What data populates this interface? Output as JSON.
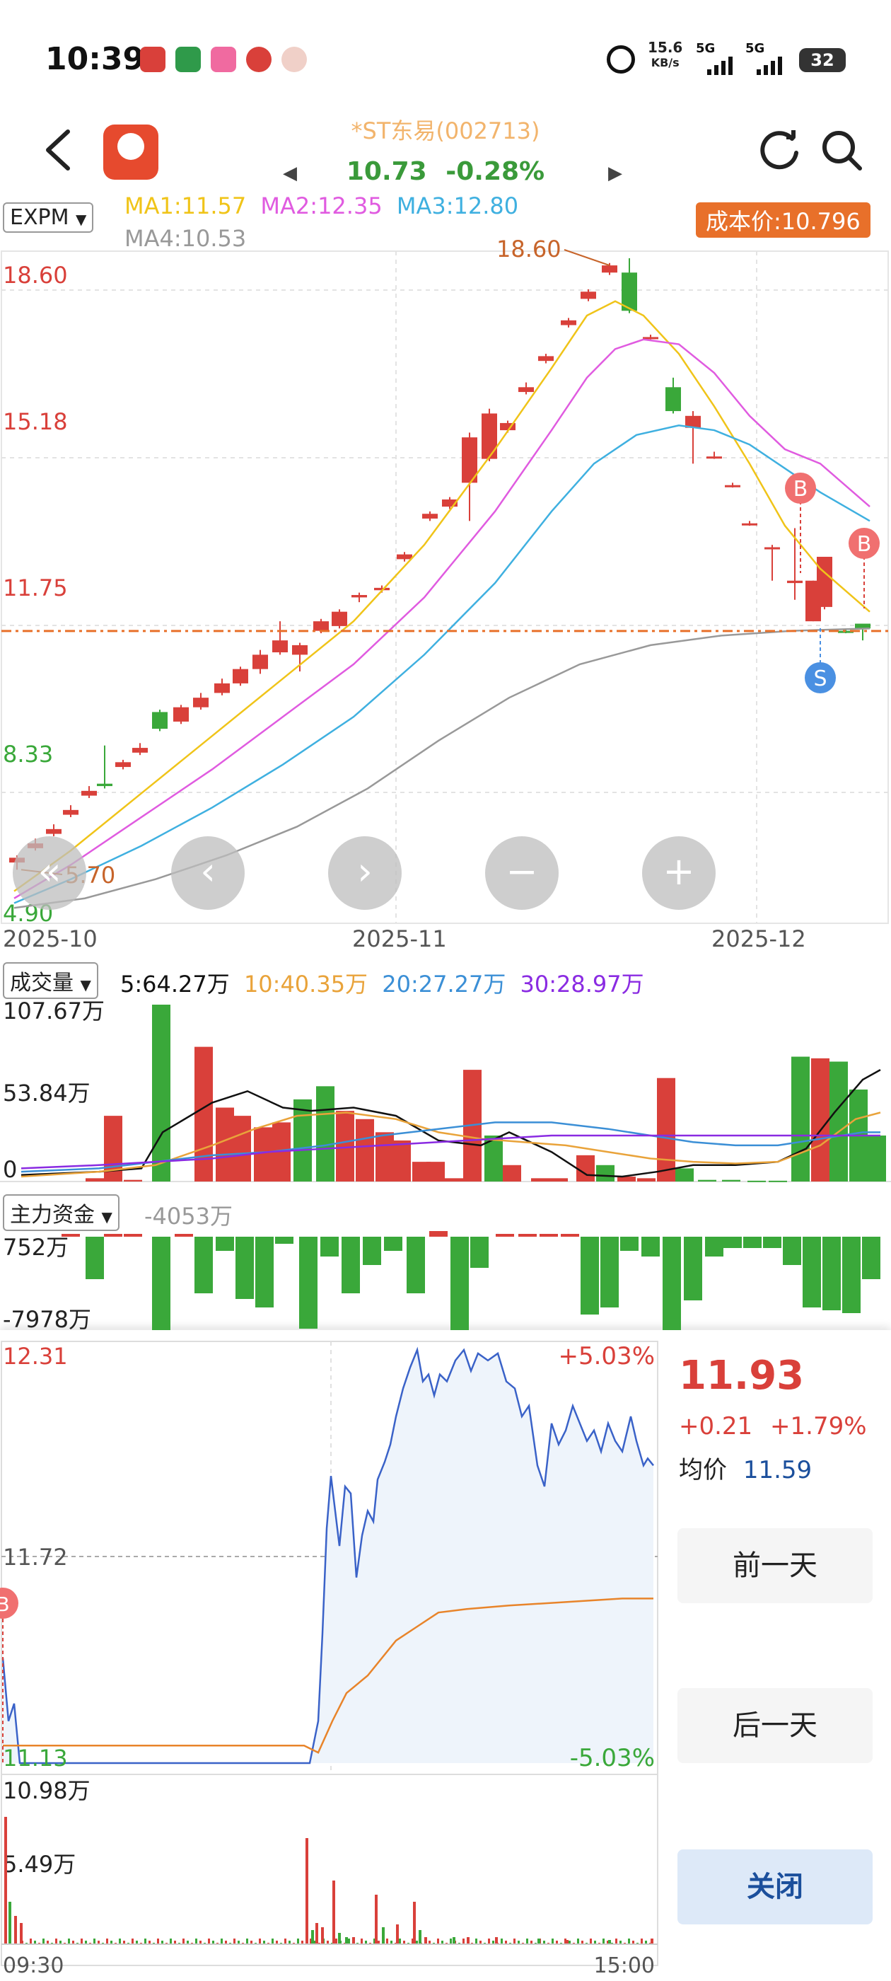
{
  "status_bar": {
    "time": "10:39",
    "speed_value": "15.6",
    "speed_unit": "KB/s",
    "net1": "5G",
    "net2": "5G",
    "battery": "32",
    "icons": [
      "bank-icon",
      "post-icon",
      "bilibili-icon",
      "merchants-bank-icon",
      "avatar-icon",
      "alarm-icon",
      "signal-icon",
      "signal-icon",
      "battery-icon"
    ]
  },
  "header": {
    "title": "*ST东易(002713)",
    "price": "10.73",
    "change": "-0.28%",
    "icons": [
      "back-icon",
      "app-logo-icon",
      "prev-arrow-icon",
      "next-arrow-icon",
      "refresh-icon",
      "search-icon"
    ]
  },
  "kline": {
    "indicator": "EXPM",
    "ma1": "MA1:11.57",
    "ma2": "MA2:12.35",
    "ma3": "MA3:12.80",
    "ma4": "MA4:10.53",
    "cost_badge": "成本价:10.796",
    "y_labels": [
      "18.60",
      "15.18",
      "11.75",
      "8.33",
      "4.90"
    ],
    "high_label": "18.60",
    "low_label": "5.70",
    "x_labels": [
      "2025-10",
      "2025-11",
      "2025-12"
    ],
    "markers": [
      "B",
      "B",
      "S"
    ],
    "controls": [
      "«",
      "‹",
      "›",
      "−",
      "+"
    ]
  },
  "volume": {
    "label": "成交量",
    "v5": "5:64.27万",
    "v10": "10:40.35万",
    "v20": "20:27.27万",
    "v30": "30:28.97万",
    "y_labels": [
      "107.67万",
      "53.84万",
      "0"
    ],
    "colors": {
      "v5": "#111111",
      "v10": "#e9a33a",
      "v20": "#3b8fd6",
      "v30": "#8a2be2"
    }
  },
  "capital": {
    "label": "主力资金",
    "value": "-4053万",
    "y_top": "752万",
    "y_bottom": "-7978万"
  },
  "intraday": {
    "y_top": "12.31",
    "y_mid": "11.72",
    "y_bottom": "11.13",
    "pct_top": "+5.03%",
    "pct_bottom": "-5.03%",
    "vol_top": "10.98万",
    "vol_mid": "5.49万",
    "time_start": "09:30",
    "time_end": "15:00",
    "marker": "B"
  },
  "side": {
    "price": "11.93",
    "change": "+0.21",
    "pct": "+1.79%",
    "avg_label": "均价",
    "avg_value": "11.59",
    "btn_prev": "前一天",
    "btn_next": "后一天",
    "btn_close": "关闭"
  },
  "colors": {
    "red": "#d9403a",
    "green": "#3aa83a",
    "ma1": "#f0c419",
    "ma2": "#e05be0",
    "ma3": "#3fb0e0",
    "ma4": "#999999",
    "cost": "#e8702a"
  }
}
